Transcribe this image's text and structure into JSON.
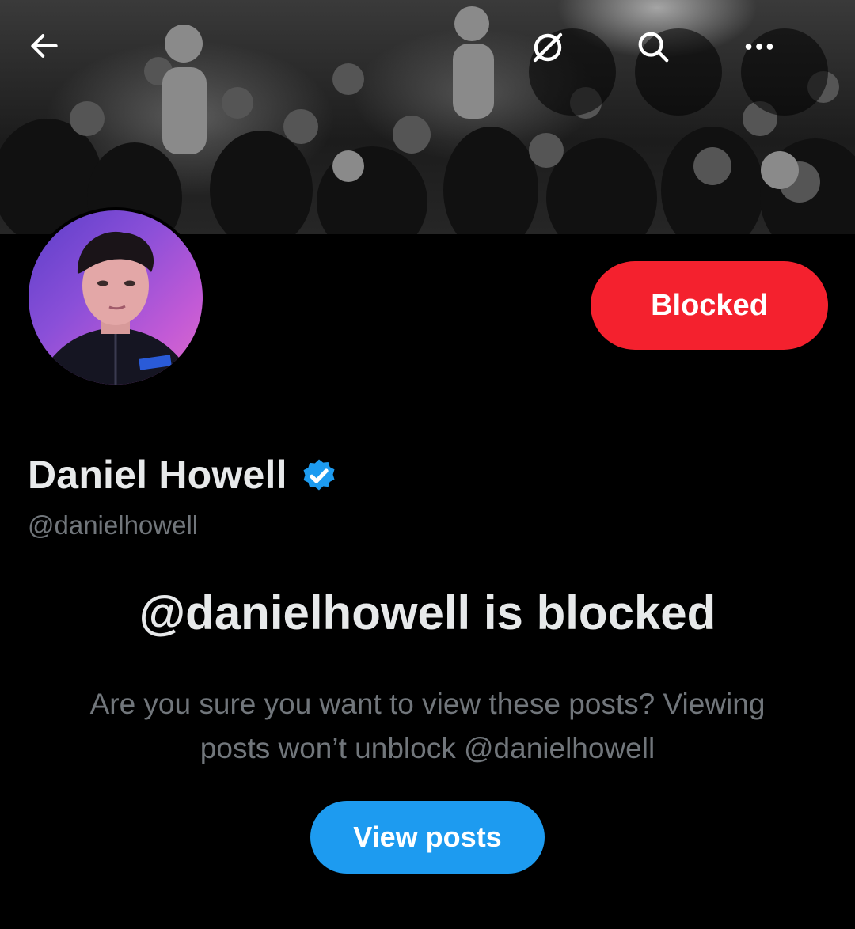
{
  "header": {
    "back_icon": "arrow-left-icon",
    "grok_icon": "grok-icon",
    "search_icon": "search-icon",
    "more_icon": "more-horizontal-icon"
  },
  "profile": {
    "display_name": "Daniel Howell",
    "handle": "@danielhowell",
    "verified": true,
    "blocked_button_label": "Blocked"
  },
  "blocked_notice": {
    "title": "@danielhowell is blocked",
    "description_line1": "Are you sure you want to view these posts? Viewing",
    "description_line2": "posts won’t unblock @danielhowell",
    "view_posts_label": "View posts"
  },
  "colors": {
    "background": "#000000",
    "blocked_red": "#f4212e",
    "accent_blue": "#1d9bf0",
    "primary_text": "#e7e9ea",
    "secondary_text": "#71767b"
  }
}
